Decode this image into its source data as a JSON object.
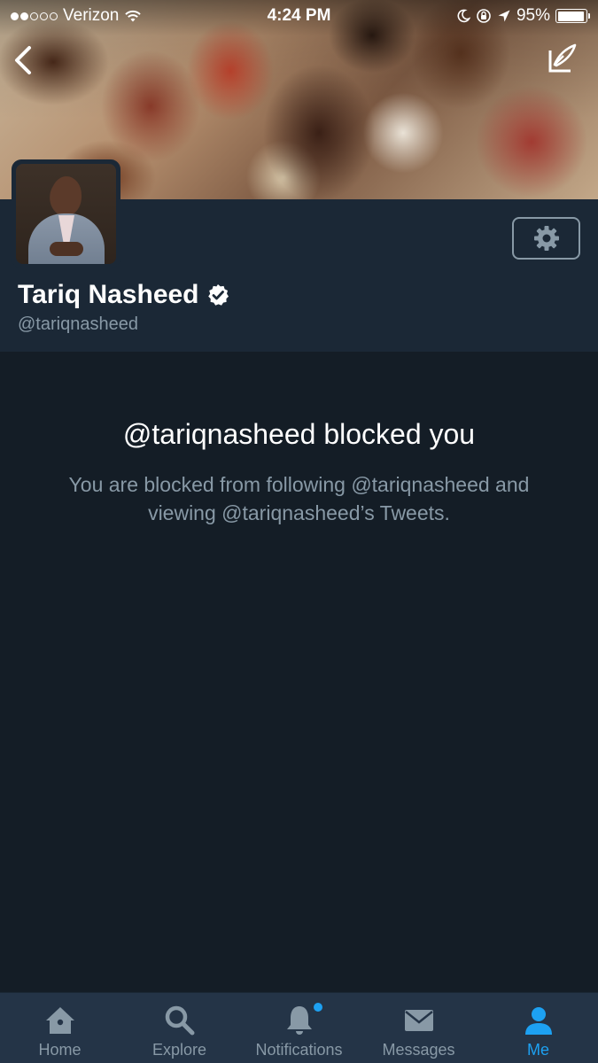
{
  "status_bar": {
    "carrier": "Verizon",
    "time": "4:24 PM",
    "battery": "95%",
    "battery_level": 0.95,
    "signal_bars_filled": 2,
    "signal_bars_total": 5
  },
  "header": {
    "back_icon": "chevron-left-icon",
    "compose_icon": "compose-icon"
  },
  "profile": {
    "display_name": "Tariq Nasheed",
    "handle": "@tariqnasheed",
    "verified": true,
    "settings_icon": "gear-icon"
  },
  "blocked": {
    "title": "@tariqnasheed blocked you",
    "description": "You are blocked from following @tariqnasheed and viewing @tariqnasheed’s Tweets."
  },
  "tabs": [
    {
      "label": "Home",
      "icon": "home-icon",
      "active": false
    },
    {
      "label": "Explore",
      "icon": "search-icon",
      "active": false
    },
    {
      "label": "Notifications",
      "icon": "bell-icon",
      "active": false,
      "badge": true
    },
    {
      "label": "Messages",
      "icon": "envelope-icon",
      "active": false
    },
    {
      "label": "Me",
      "icon": "person-icon",
      "active": true
    }
  ],
  "colors": {
    "background": "#141d26",
    "panel": "#1b2836",
    "tab_bar": "#243447",
    "muted": "#8899a6",
    "accent": "#1da1f2"
  }
}
